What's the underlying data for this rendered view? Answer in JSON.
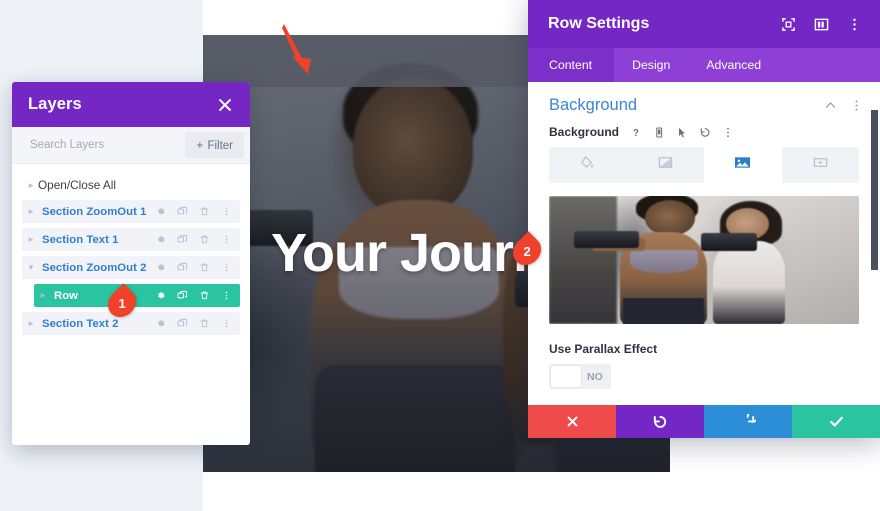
{
  "hero": {
    "heading": "Your Journ"
  },
  "annotations": {
    "arrow": "red-arrow-pointing-down",
    "badge_one": "1",
    "badge_two": "2"
  },
  "layers_panel": {
    "title": "Layers",
    "close_icon": "close-icon",
    "search": {
      "placeholder": "Search Layers",
      "value": ""
    },
    "filter_button": {
      "plus": "+",
      "label": "Filter"
    },
    "open_close_all": "Open/Close All",
    "row_icons": [
      "gear-icon",
      "duplicate-icon",
      "trash-icon",
      "more-vertical-icon"
    ],
    "items": [
      {
        "label": "Section ZoomOut 1",
        "active": false,
        "indent": false
      },
      {
        "label": "Section Text 1",
        "active": false,
        "indent": false
      },
      {
        "label": "Section ZoomOut 2",
        "active": false,
        "indent": false
      },
      {
        "label": "Row",
        "active": true,
        "indent": true
      },
      {
        "label": "Section Text 2",
        "active": false,
        "indent": false
      }
    ]
  },
  "row_settings": {
    "title": "Row Settings",
    "header_icons": [
      "expand-icon",
      "columns-icon",
      "more-vertical-icon"
    ],
    "tabs": [
      {
        "label": "Content",
        "active": true
      },
      {
        "label": "Design",
        "active": false
      },
      {
        "label": "Advanced",
        "active": false
      }
    ],
    "background_section": {
      "title": "Background",
      "collapse_icon": "chevron-up-icon",
      "more_icon": "more-vertical-icon",
      "field_label": "Background",
      "field_icons": [
        "help-icon",
        "mobile-icon",
        "cursor-icon",
        "reset-icon",
        "more-vertical-icon"
      ],
      "type_tabs": [
        {
          "icon": "paint-bucket-icon",
          "name": "background-color",
          "active": false
        },
        {
          "icon": "gradient-icon",
          "name": "background-gradient",
          "active": false
        },
        {
          "icon": "image-icon",
          "name": "background-image",
          "active": true
        },
        {
          "icon": "video-icon",
          "name": "background-video",
          "active": false
        }
      ],
      "preview_alt": "two-women-lifting-dumbbells-gym-photo"
    },
    "parallax": {
      "label": "Use Parallax Effect",
      "toggle_value": "NO"
    },
    "footer_buttons": [
      {
        "name": "cancel-button",
        "icon": "x-icon",
        "color": "#ef4b4b"
      },
      {
        "name": "undo-button",
        "icon": "undo-icon",
        "color": "#7427c4"
      },
      {
        "name": "redo-button",
        "icon": "redo-icon",
        "color": "#2c8ed6"
      },
      {
        "name": "save-button",
        "icon": "check-icon",
        "color": "#2ac4a1"
      }
    ]
  },
  "colors": {
    "purple": "#7427c4",
    "purple_light": "#8e3fd6",
    "teal": "#2ac4a1",
    "red": "#ef4b4b",
    "blue": "#2c8ed6",
    "annotation_red": "#f0422a",
    "link_blue": "#2f7fd1",
    "section_title_blue": "#3a86d6"
  }
}
